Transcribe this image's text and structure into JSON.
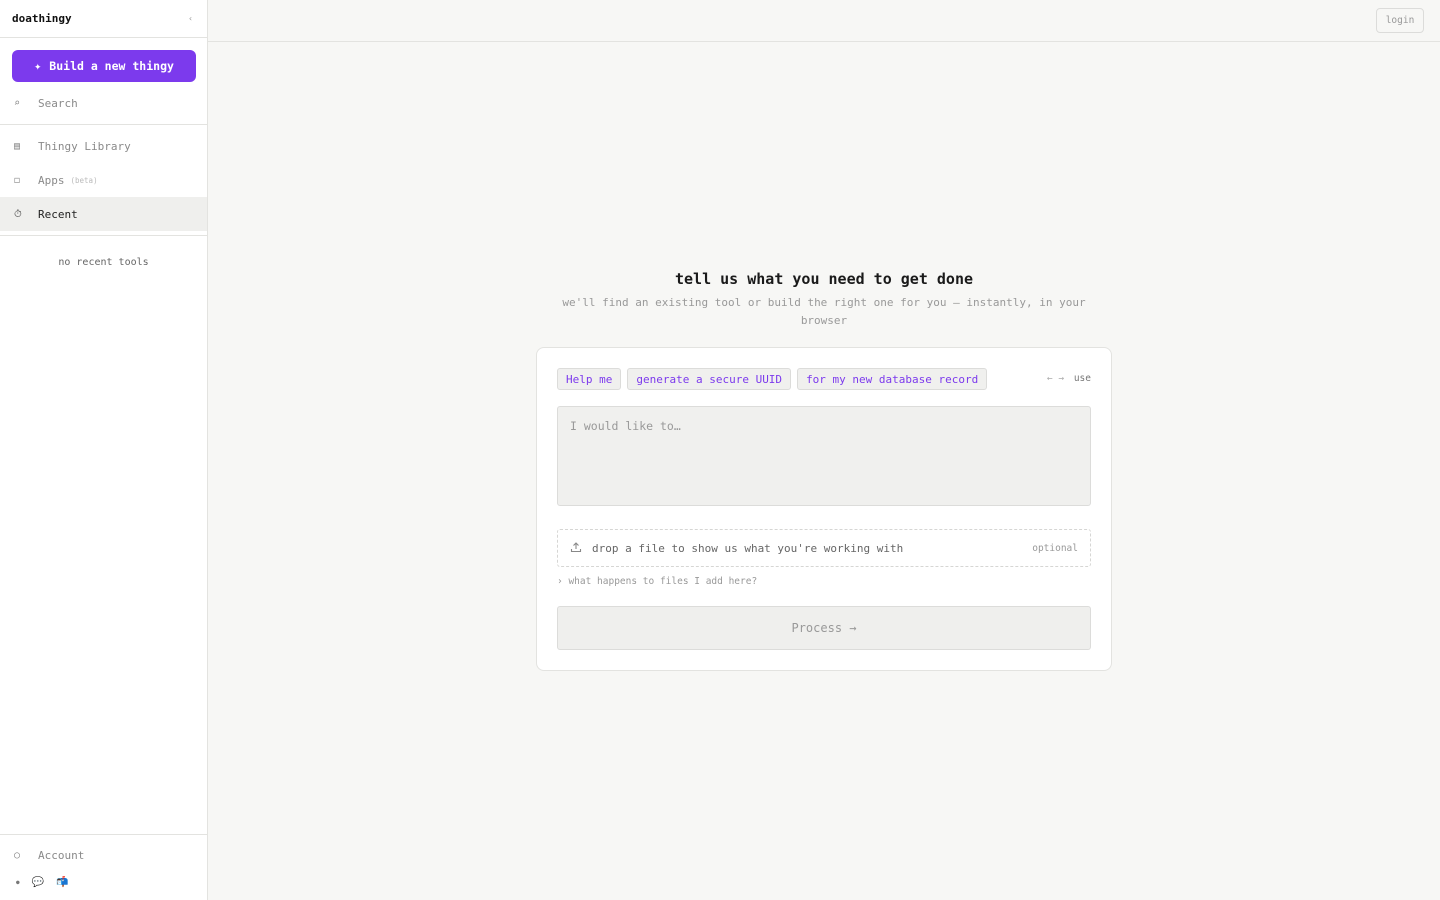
{
  "sidebar": {
    "brand": "doathingy",
    "collapse_icon": "chevron-left-icon",
    "collapse_glyph": "‹",
    "build_button": {
      "icon": "sparkle-icon",
      "glyph": "✦",
      "label": "Build a new thingy"
    },
    "search": {
      "icon": "search-icon",
      "glyph": "⌕",
      "label": "Search"
    },
    "items": [
      {
        "icon": "library-icon",
        "glyph": "▤",
        "label": "Thingy Library"
      },
      {
        "icon": "apps-icon",
        "glyph": "◻",
        "label": "Apps",
        "badge": "(beta)"
      },
      {
        "icon": "clock-icon",
        "glyph": "⏱",
        "label": "Recent",
        "active": true
      }
    ],
    "empty_recent": "no recent tools",
    "account": {
      "icon": "user-icon",
      "glyph": "○",
      "label": "Account"
    },
    "footer_icons": [
      {
        "icon": "dot-icon",
        "glyph": "●"
      },
      {
        "icon": "chat-icon",
        "glyph": "💬"
      },
      {
        "icon": "mailbox-icon",
        "glyph": "📬"
      }
    ]
  },
  "topbar": {
    "login_label": "login"
  },
  "main": {
    "heading": "tell us what you need to get done",
    "subheading": "we'll find an existing tool or build the right one for you — instantly, in your browser",
    "chips": [
      "Help me",
      "generate a secure UUID",
      "for my new database record"
    ],
    "use_hint": {
      "arrows": "← →",
      "label": "use"
    },
    "prompt_placeholder": "I would like to…",
    "dropzone": {
      "icon": "upload-icon",
      "glyph": "⇪",
      "label": "drop a file to show us what you're working with",
      "optional": "optional"
    },
    "files_link": "› what happens to files I add here?",
    "process_label": "Process →"
  },
  "colors": {
    "accent": "#7c3aed",
    "background": "#f7f7f5",
    "sidebar": "#ffffff"
  }
}
